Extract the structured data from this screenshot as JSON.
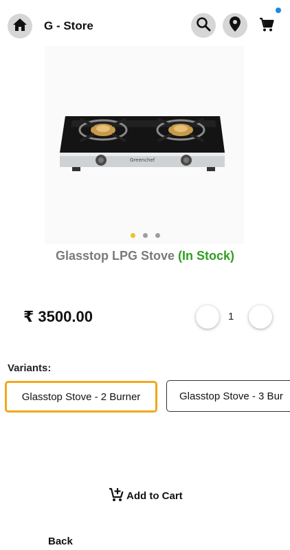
{
  "header": {
    "title": "G - Store",
    "home_icon": "home-icon",
    "search_icon": "search-icon",
    "location_icon": "location-pin-icon",
    "cart_icon": "cart-icon",
    "badge_color": "#1a88e0"
  },
  "product": {
    "name": "Glasstop LPG Stove",
    "stock": "(In Stock)",
    "stock_color": "#2e9e1f",
    "image_brand": "Greenchef",
    "carousel": {
      "total": 3,
      "active_index": 0,
      "active_color": "#f0c020"
    },
    "price": "₹ 3500.00",
    "quantity": "1"
  },
  "variants": {
    "label": "Variants:",
    "items": [
      {
        "label": "Glasstop Stove - 2 Burner",
        "selected": true
      },
      {
        "label": "Glasstop Stove - 3 Bur",
        "selected": false
      }
    ],
    "selected_color": "#f0a81c"
  },
  "actions": {
    "add_to_cart": "Add to Cart",
    "back": "Back"
  }
}
